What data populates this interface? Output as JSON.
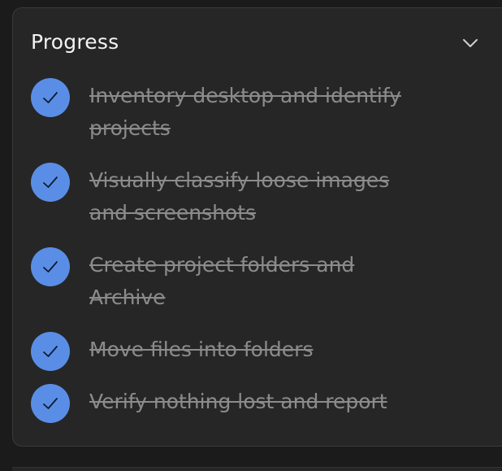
{
  "panel": {
    "title": "Progress",
    "toggle_icon": "chevron-down-icon"
  },
  "colors": {
    "check_fill": "#5a8ee6",
    "done_text": "#8b8b8b",
    "title_text": "#f2f2f2",
    "panel_bg": "#262626"
  },
  "tasks": [
    {
      "label": "Inventory desktop and identify projects",
      "done": true
    },
    {
      "label": "Visually classify loose images and screenshots",
      "done": true
    },
    {
      "label": "Create project folders and Archive",
      "done": true
    },
    {
      "label": "Move files into folders",
      "done": true
    },
    {
      "label": "Verify nothing lost and report",
      "done": true
    }
  ]
}
